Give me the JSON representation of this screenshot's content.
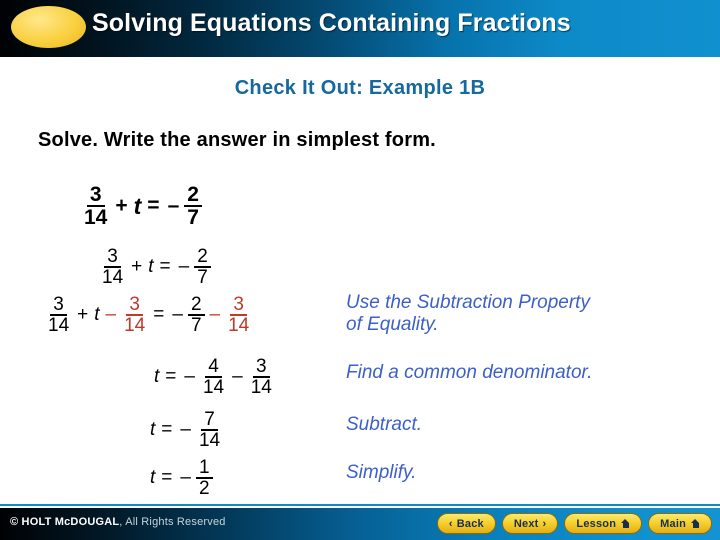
{
  "header": {
    "title": "Solving Equations Containing Fractions",
    "ellipse_color": "#f9cf3d",
    "gradient_from": "#000204",
    "gradient_to": "#1190cf"
  },
  "subtitle": "Check It Out: Example 1B",
  "instruction": "Solve. Write the answer in simplest form.",
  "accent_color": "#c0392b",
  "note_color": "#3c5fca",
  "equations": {
    "line1": {
      "frac_a_num": "3",
      "frac_a_den": "14",
      "op_plus": "+",
      "variable": "t",
      "equals": "=",
      "minus": "–",
      "frac_b_num": "2",
      "frac_b_den": "7"
    },
    "line2": {
      "frac_a_num": "3",
      "frac_a_den": "14",
      "op_plus": "+",
      "variable": "t",
      "equals": "=",
      "minus": "–",
      "frac_b_num": "2",
      "frac_b_den": "7"
    },
    "line3": {
      "frac_a_num": "3",
      "frac_a_den": "14",
      "op_plus": "+",
      "variable": "t",
      "minus_1": "–",
      "frac_b_num": "3",
      "frac_b_den": "14",
      "equals": "=",
      "minus_2": "–",
      "frac_c_num": "2",
      "frac_c_den": "7",
      "minus_3": "–",
      "frac_d_num": "3",
      "frac_d_den": "14"
    },
    "line4": {
      "variable": "t",
      "equals": "=",
      "minus_1": "–",
      "frac_a_num": "4",
      "frac_a_den": "14",
      "minus_2": "–",
      "frac_b_num": "3",
      "frac_b_den": "14"
    },
    "line5": {
      "variable": "t",
      "equals": "=",
      "minus": "–",
      "frac_num": "7",
      "frac_den": "14"
    },
    "line6": {
      "variable": "t",
      "equals": "=",
      "minus": "–",
      "frac_num": "1",
      "frac_den": "2"
    }
  },
  "notes": {
    "note1": "Use the Subtraction Property\nof Equality.",
    "note2": "Find a common denominator.",
    "note3": "Subtract.",
    "note4": "Simplify."
  },
  "footer": {
    "copyright_brand": "© HOLT McDOUGAL",
    "copyright_rest": ", All Rights Reserved",
    "buttons": [
      {
        "label": "Back",
        "icon": "chevron-left-icon",
        "glyph": "‹"
      },
      {
        "label": "Next",
        "icon": "chevron-right-icon",
        "glyph": "›"
      },
      {
        "label": "Lesson",
        "icon": "home-icon",
        "glyph": ""
      },
      {
        "label": "Main",
        "icon": "home-icon",
        "glyph": ""
      }
    ]
  }
}
